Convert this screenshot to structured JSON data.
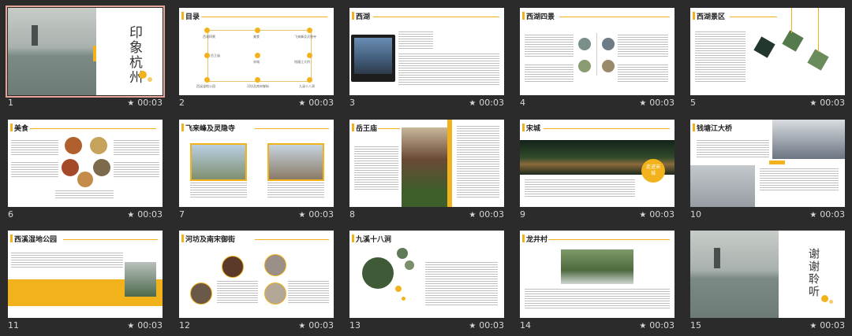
{
  "slides": [
    {
      "number": "1",
      "time": "00:03",
      "title": "印象杭州"
    },
    {
      "number": "2",
      "time": "00:03",
      "title": "目录",
      "items": [
        "西湖四景",
        "美食",
        "飞来峰及灵隐寺",
        "岳王庙",
        "宋城",
        "钱塘江大桥",
        "西溪湿地公园",
        "河坊及南宋御街",
        "九溪十八涧",
        "龙井村"
      ]
    },
    {
      "number": "3",
      "time": "00:03",
      "title": "西湖"
    },
    {
      "number": "4",
      "time": "00:03",
      "title": "西湖四景"
    },
    {
      "number": "5",
      "time": "00:03",
      "title": "西湖景区"
    },
    {
      "number": "6",
      "time": "00:03",
      "title": "美食"
    },
    {
      "number": "7",
      "time": "00:03",
      "title": "飞来峰及灵隐寺"
    },
    {
      "number": "8",
      "time": "00:03",
      "title": "岳王庙"
    },
    {
      "number": "9",
      "time": "00:03",
      "title": "宋城",
      "badge": "走进宋城"
    },
    {
      "number": "10",
      "time": "00:03",
      "title": "钱塘江大桥"
    },
    {
      "number": "11",
      "time": "00:03",
      "title": "西溪湿地公园"
    },
    {
      "number": "12",
      "time": "00:03",
      "title": "河坊及南宋御街"
    },
    {
      "number": "13",
      "time": "00:03",
      "title": "九溪十八涧"
    },
    {
      "number": "14",
      "time": "00:03",
      "title": "龙井村"
    },
    {
      "number": "15",
      "time": "00:03",
      "title": "谢谢聆听"
    }
  ],
  "colors": {
    "accent": "#f2b21b",
    "background": "#2b2b2b",
    "selected_outline": "#e8a69a"
  },
  "icons": {
    "timing": "star-icon"
  }
}
